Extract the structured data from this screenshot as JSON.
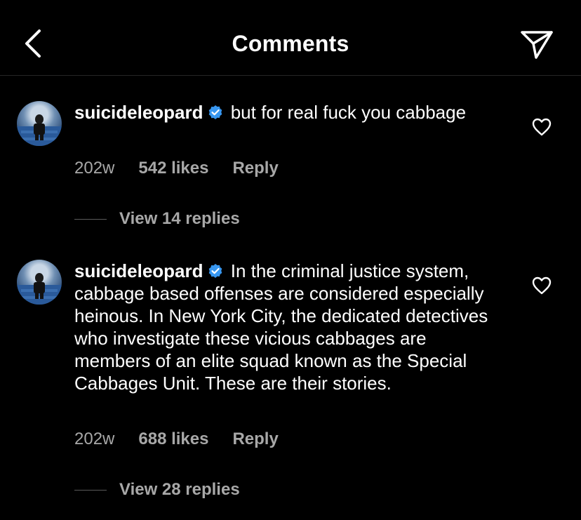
{
  "header": {
    "title": "Comments",
    "back_icon": "chevron-left-icon",
    "send_icon": "paper-plane-icon"
  },
  "comments": [
    {
      "username": "suicideleopard",
      "verified": true,
      "text": "but for real fuck you cabbage",
      "age": "202w",
      "likes": "542 likes",
      "reply_label": "Reply",
      "view_replies": "View 14 replies"
    },
    {
      "username": "suicideleopard",
      "verified": true,
      "text": "In the criminal justice system, cabbage based offenses are considered especially heinous. In New York City, the dedicated detectives who investigate these vicious cabbages are members of an elite squad known as the Special Cabbages Unit. These are their stories.",
      "age": "202w",
      "likes": "688 likes",
      "reply_label": "Reply",
      "view_replies": "View 28 replies"
    }
  ],
  "colors": {
    "background": "#000000",
    "text": "#ffffff",
    "secondary": "#a8a8a8",
    "verified": "#3897f0"
  }
}
